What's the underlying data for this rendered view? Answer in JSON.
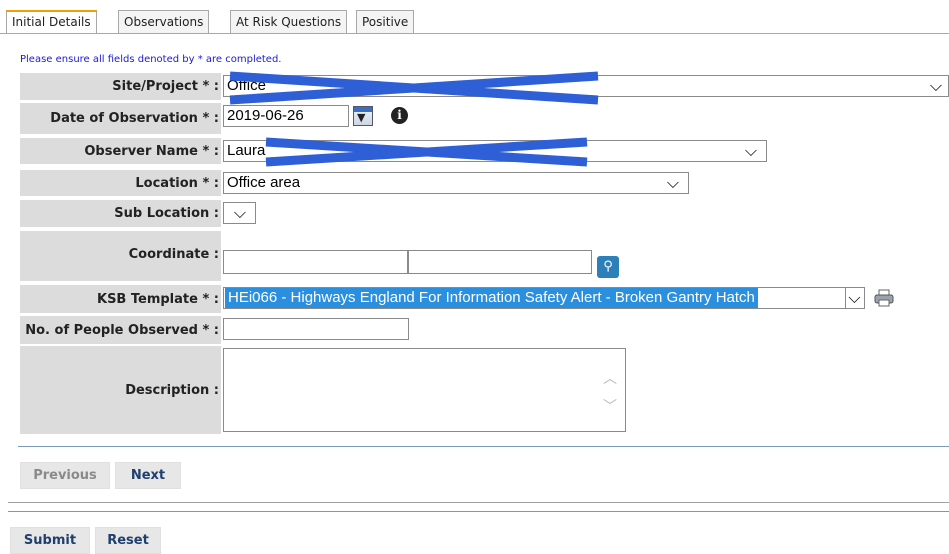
{
  "tabs": [
    {
      "label": "Initial Details",
      "active": true
    },
    {
      "label": "Observations",
      "active": false
    },
    {
      "label": "At Risk Questions",
      "active": false
    },
    {
      "label": "Positive",
      "active": false
    }
  ],
  "notice": "Please ensure all fields denoted by * are completed.",
  "form": {
    "site": {
      "label": "Site/Project * :",
      "value": "Office"
    },
    "date": {
      "label": "Date of Observation * :",
      "value": "2019-06-26"
    },
    "observer": {
      "label": "Observer Name * :",
      "value": "Laura"
    },
    "location": {
      "label": "Location * :",
      "value": "Office area"
    },
    "sub_location": {
      "label": "Sub Location :",
      "value": ""
    },
    "coordinate": {
      "label": "Coordinate :",
      "lat": "",
      "lon": ""
    },
    "ksb": {
      "label": "KSB Template * :",
      "value": "HEi066 - Highways England For Information Safety Alert - Broken Gantry Hatch"
    },
    "people": {
      "label": "No. of People Observed * :",
      "value": ""
    },
    "description": {
      "label": "Description :",
      "value": ""
    }
  },
  "icons": {
    "dropdown": "chevron-down-icon",
    "calendar": "calendar-icon",
    "info": "info-icon",
    "map_pin": "map-pin-icon",
    "print": "printer-icon",
    "redaction": "redaction-mark"
  },
  "nav": {
    "previous": "Previous",
    "next": "Next"
  },
  "actions": {
    "submit": "Submit",
    "reset": "Reset"
  },
  "colors": {
    "tab_accent": "#f0a000",
    "label_bg": "#dcdcdc",
    "selected": "#2b8fe0",
    "redaction": "#2f5fd6",
    "button_text": "#1f3f6e"
  }
}
